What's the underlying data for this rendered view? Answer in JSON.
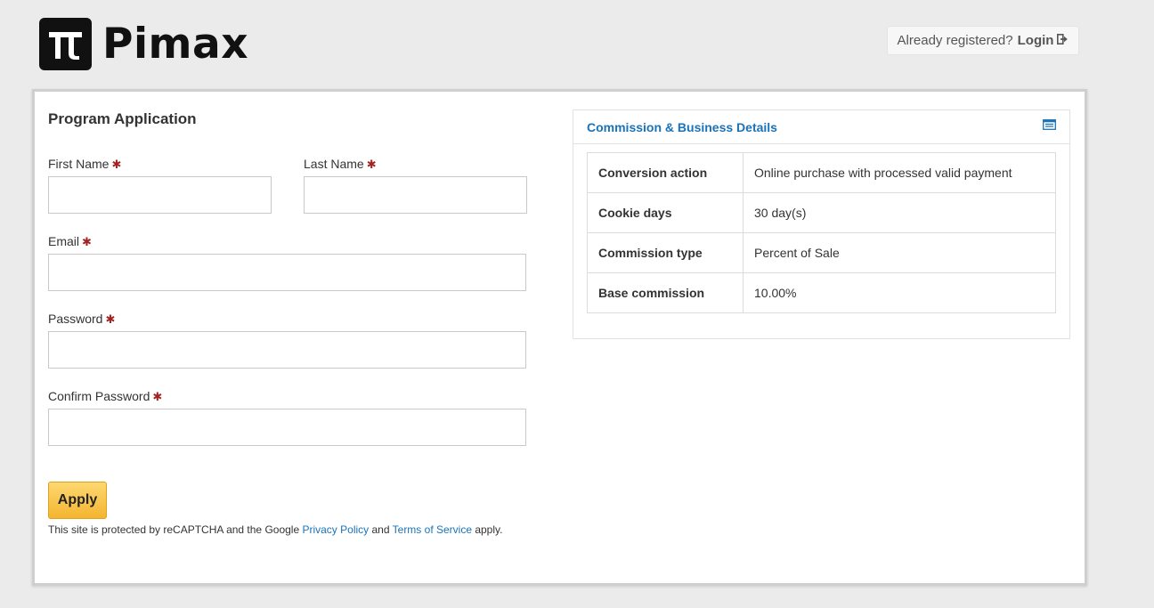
{
  "brand": {
    "name": "Pimax"
  },
  "header": {
    "already_registered": "Already registered?",
    "login_label": "Login"
  },
  "form": {
    "title": "Program Application",
    "required_mark": "✱",
    "first_name_label": "First Name",
    "last_name_label": "Last Name",
    "email_label": "Email",
    "password_label": "Password",
    "confirm_password_label": "Confirm Password",
    "first_name_value": "",
    "last_name_value": "",
    "email_value": "",
    "password_value": "",
    "confirm_password_value": "",
    "apply_label": "Apply",
    "recaptcha": {
      "prefix": "This site is protected by reCAPTCHA and the Google ",
      "privacy_link": "Privacy Policy",
      "and": " and ",
      "terms_link": "Terms of Service",
      "suffix": " apply."
    }
  },
  "details": {
    "title": "Commission & Business Details",
    "icon": "list-icon",
    "rows": [
      {
        "key": "Conversion action",
        "value": "Online purchase with processed valid payment"
      },
      {
        "key": "Cookie days",
        "value": "30 day(s)"
      },
      {
        "key": "Commission type",
        "value": "Percent of Sale"
      },
      {
        "key": "Base commission",
        "value": "10.00%"
      }
    ]
  },
  "colors": {
    "link": "#1a73b8",
    "required": "#a12323",
    "button": "#f3b531"
  }
}
